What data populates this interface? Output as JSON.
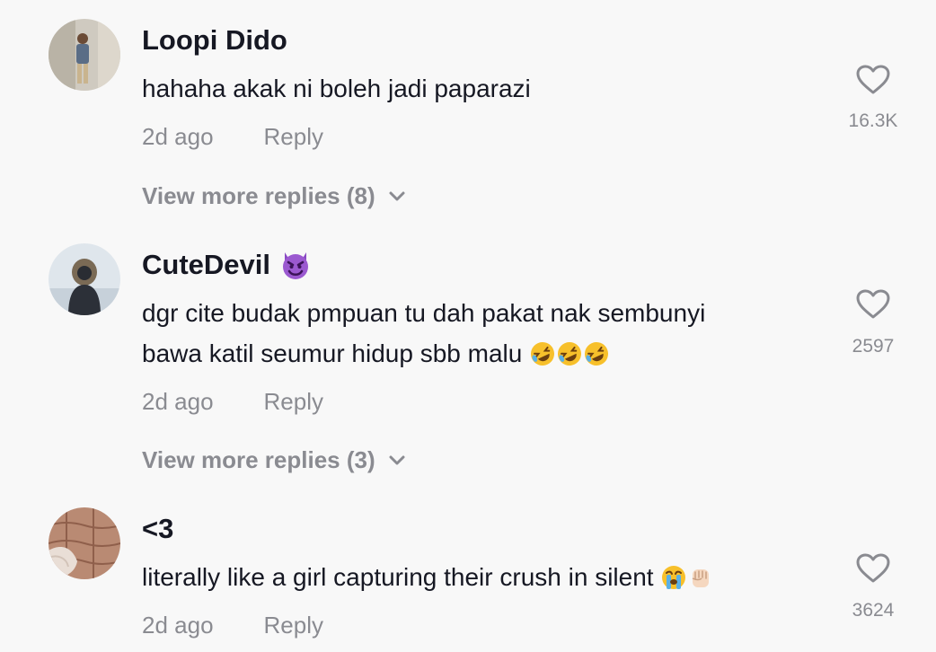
{
  "comments": [
    {
      "username": "Loopi Dido",
      "text_lines": [
        "hahaha akak ni boleh jadi paparazi"
      ],
      "time": "2d ago",
      "reply_label": "Reply",
      "like_count": "16.3K",
      "view_more": "View more replies (8)"
    },
    {
      "username": "CuteDevil",
      "username_emoji": "smiling-devil",
      "text_lines": [
        "dgr cite budak pmpuan tu dah pakat nak sembunyi",
        "bawa katil seumur hidup sbb malu"
      ],
      "text_emojis": [
        "rolling-on-floor-laughing",
        "rolling-on-floor-laughing",
        "rolling-on-floor-laughing"
      ],
      "time": "2d ago",
      "reply_label": "Reply",
      "like_count": "2597",
      "view_more": "View more replies (3)"
    },
    {
      "username": "<3",
      "text_lines": [
        "literally like a girl capturing their crush in silent"
      ],
      "text_emojis": [
        "loudly-crying-face",
        "raised-fist"
      ],
      "time": "2d ago",
      "reply_label": "Reply",
      "like_count": "3624"
    }
  ],
  "colors": {
    "background": "#f8f8f8",
    "username": "#161823",
    "secondary": "#8a8b91"
  }
}
